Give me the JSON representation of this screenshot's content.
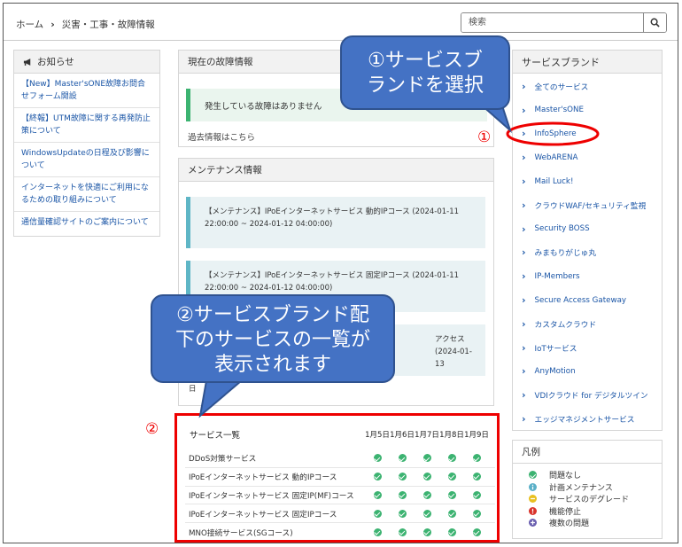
{
  "breadcrumb": {
    "home": "ホーム",
    "separator": "›",
    "current": "災害・工事・故障情報"
  },
  "search": {
    "placeholder": "検索"
  },
  "notices": {
    "title": "お知らせ",
    "items": [
      "【New】Master'sONE故障お問合せフォーム開設",
      "【終報】UTM故障に関する再発防止策について",
      "WindowsUpdateの日程及び影響について",
      "インターネットを快適にご利用になるための取り組みについて",
      "通信量確認サイトのご案内について"
    ]
  },
  "fault": {
    "title": "現在の故障情報",
    "status": "発生している故障はありません",
    "past_link": "過去情報はこちら"
  },
  "maintenance": {
    "title": "メンテナンス情報",
    "items": [
      {
        "l1": "【メンテナンス】IPoEインターネットサービス 動的IPコース (2024-01-11",
        "l2": "22:00:00 ~ 2024-01-12 04:00:00)"
      },
      {
        "l1": "【メンテナンス】IPoEインターネットサービス 固定IPコース (2024-01-11",
        "l2": "22:00:00 ~ 2024-01-12 04:00:00)"
      },
      {
        "l1": "アクセス (2024-01-13",
        "l2": ""
      }
    ]
  },
  "brands": {
    "title": "サービスブランド",
    "items": [
      "全てのサービス",
      "Master'sONE",
      "InfoSphere",
      "WebARENA",
      "Mail Luck!",
      "クラウドWAF/セキュリティ監視",
      "Security BOSS",
      "みまもりがじゅ丸",
      "IP-Members",
      "Secure Access Gateway",
      "カスタムクラウド",
      "IoTサービス",
      "AnyMotion",
      "VDIクラウド for デジタルツイン",
      "エッジマネジメントサービス"
    ]
  },
  "legend": {
    "title": "凡例",
    "items": [
      {
        "label": "問題なし",
        "color": "#3cb371"
      },
      {
        "label": "計画メンテナンス",
        "color": "#5bb0c8"
      },
      {
        "label": "サービスのデグレード",
        "color": "#e8c020"
      },
      {
        "label": "機能停止",
        "color": "#d9332b"
      },
      {
        "label": "複数の問題",
        "color": "#6a5fb0"
      }
    ]
  },
  "services": {
    "title": "サービス一覧",
    "dates": [
      "1月5日",
      "1月6日",
      "1月7日",
      "1月8日",
      "1月9日"
    ],
    "rows": [
      "DDoS対策サービス",
      "IPoEインターネットサービス 動的IPコース",
      "IPoEインターネットサービス 固定IP(MF)コース",
      "IPoEインターネットサービス 固定IPコース",
      "MNO接続サービス(SGコース)"
    ]
  },
  "annotations": {
    "callout1": "①サービスブランドを選択",
    "callout1_l1": "①サービスブ",
    "callout1_l2": "ランドを選択",
    "callout2_l1": "②サービスブランド配",
    "callout2_l2": "下のサービスの一覧が",
    "callout2_l3": "表示されます",
    "marker1": "①",
    "marker2": "②"
  }
}
